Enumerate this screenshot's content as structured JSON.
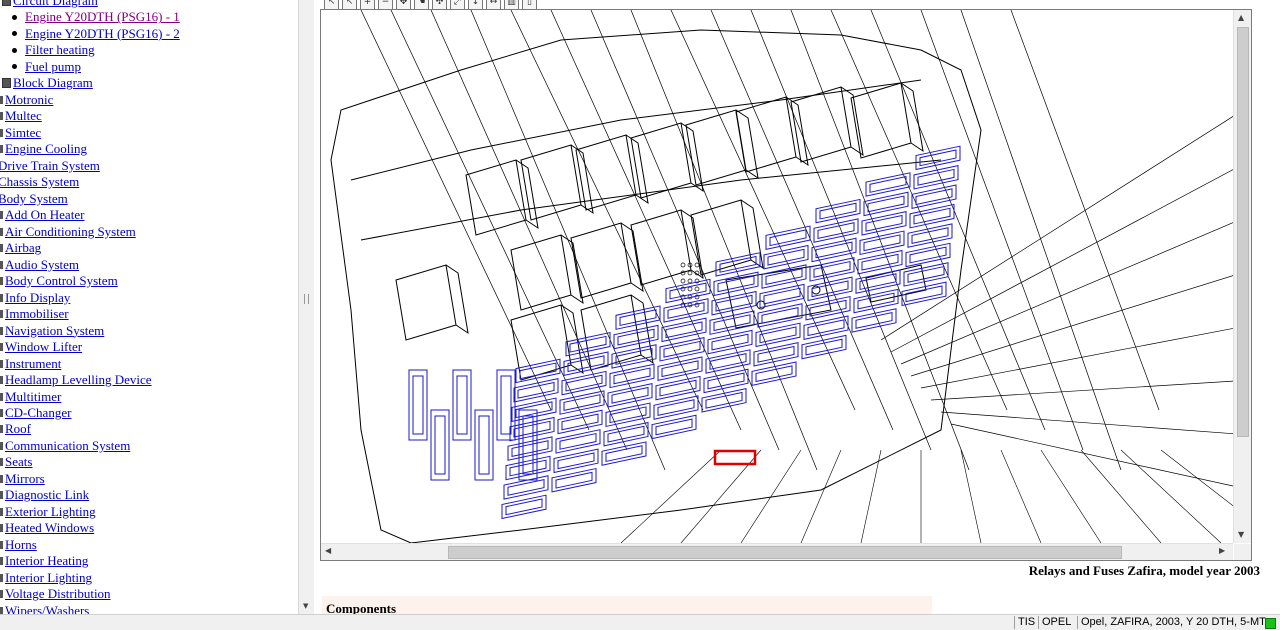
{
  "tree": {
    "items": [
      {
        "label": "Circuit Diagram",
        "kind": "folder-partial",
        "indent": 1
      },
      {
        "label": "Engine Y20DTH (PSG16) - 1",
        "kind": "bullet",
        "visited": true
      },
      {
        "label": "Engine Y20DTH (PSG16) - 2",
        "kind": "bullet"
      },
      {
        "label": "Filter heating",
        "kind": "bullet"
      },
      {
        "label": "Fuel pump",
        "kind": "bullet"
      },
      {
        "label": "Block Diagram",
        "kind": "folder"
      },
      {
        "label": "Motronic",
        "kind": "node"
      },
      {
        "label": "Multec",
        "kind": "node"
      },
      {
        "label": "Simtec",
        "kind": "node"
      },
      {
        "label": "Engine Cooling",
        "kind": "node"
      },
      {
        "label": "Drive Train System",
        "kind": "root"
      },
      {
        "label": "Chassis System",
        "kind": "root"
      },
      {
        "label": "Body System",
        "kind": "root"
      },
      {
        "label": "Add On Heater",
        "kind": "node"
      },
      {
        "label": "Air Conditioning System",
        "kind": "node"
      },
      {
        "label": "Airbag",
        "kind": "node"
      },
      {
        "label": "Audio System",
        "kind": "node"
      },
      {
        "label": "Body Control System",
        "kind": "node"
      },
      {
        "label": "Info Display",
        "kind": "node"
      },
      {
        "label": "Immobiliser",
        "kind": "node"
      },
      {
        "label": "Navigation System",
        "kind": "node"
      },
      {
        "label": "Window Lifter",
        "kind": "node"
      },
      {
        "label": "Instrument",
        "kind": "node"
      },
      {
        "label": "Headlamp Levelling Device",
        "kind": "node"
      },
      {
        "label": "Multitimer",
        "kind": "node"
      },
      {
        "label": "CD-Changer",
        "kind": "node"
      },
      {
        "label": "Roof",
        "kind": "node"
      },
      {
        "label": "Communication System",
        "kind": "node"
      },
      {
        "label": "Seats",
        "kind": "node"
      },
      {
        "label": "Mirrors",
        "kind": "node"
      },
      {
        "label": "Diagnostic Link",
        "kind": "node"
      },
      {
        "label": "Exterior Lighting",
        "kind": "node"
      },
      {
        "label": "Heated Windows",
        "kind": "node"
      },
      {
        "label": "Horns",
        "kind": "node"
      },
      {
        "label": "Interior Heating",
        "kind": "node"
      },
      {
        "label": "Interior Lighting",
        "kind": "node"
      },
      {
        "label": "Voltage Distribution",
        "kind": "node"
      },
      {
        "label": "Wipers/Washers",
        "kind": "node"
      }
    ]
  },
  "toolbar": {
    "buttons": [
      {
        "name": "select-arrow-icon",
        "glyph": "↖"
      },
      {
        "name": "select-plus-icon",
        "glyph": "↖"
      },
      {
        "name": "zoom-in-icon",
        "glyph": "+"
      },
      {
        "name": "zoom-out-icon",
        "glyph": "−"
      },
      {
        "name": "pan-icon",
        "glyph": "✥"
      },
      {
        "name": "hand-icon",
        "glyph": "☚"
      },
      {
        "name": "move-icon",
        "glyph": "✣"
      },
      {
        "name": "fit-window-icon",
        "glyph": "⤢"
      },
      {
        "name": "fit-height-icon",
        "glyph": "↕"
      },
      {
        "name": "fit-width-icon",
        "glyph": "↔"
      },
      {
        "name": "measure-icon",
        "glyph": "▥"
      },
      {
        "name": "print-icon",
        "glyph": "▯"
      }
    ]
  },
  "viewer": {
    "caption": "Relays and Fuses Zafira, model year 2003"
  },
  "components": {
    "heading": "Components"
  },
  "statusbar": {
    "app": "TIS",
    "brand": "OPEL",
    "vehicle": "Opel, ZAFIRA, 2003, Y 20 DTH, 5-MT",
    "status_color": "#19c219"
  },
  "colors": {
    "link": "#0000cc",
    "visited_link": "#800080",
    "fuse_lines": "#1a1acc",
    "highlight": "#e00000"
  }
}
